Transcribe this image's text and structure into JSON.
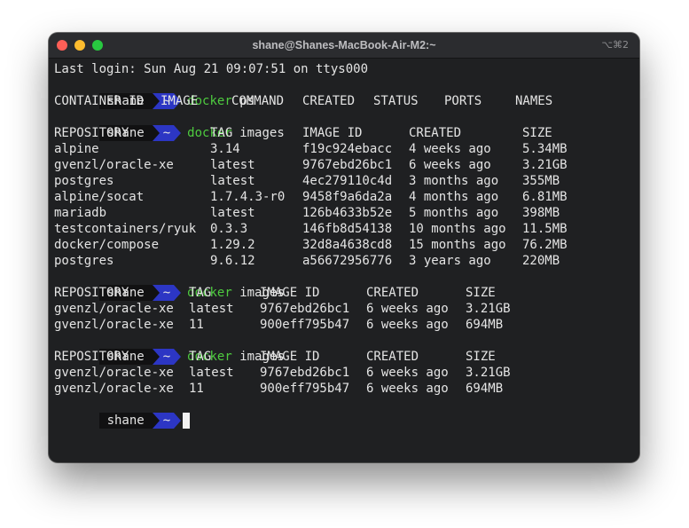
{
  "window": {
    "title": "shane@Shanes-MacBook-Air-M2:~",
    "shortcut": "⌥⌘2"
  },
  "terminal": {
    "last_login": "Last login: Sun Aug 21 09:07:51 on ttys000",
    "prompt": {
      "user": "shane",
      "dir": "~"
    },
    "ps": {
      "command": {
        "bin": "docker",
        "args": "ps"
      },
      "headers": [
        "CONTAINER ID",
        "IMAGE",
        "COMMAND",
        "CREATED",
        "STATUS",
        "PORTS",
        "NAMES"
      ]
    },
    "images1": {
      "command": {
        "bin": "docker",
        "args": "images"
      },
      "headers": [
        "REPOSITORY",
        "TAG",
        "IMAGE ID",
        "CREATED",
        "SIZE"
      ],
      "rows": [
        [
          "alpine",
          "3.14",
          "f19c924ebacc",
          "4 weeks ago",
          "5.34MB"
        ],
        [
          "gvenzl/oracle-xe",
          "latest",
          "9767ebd26bc1",
          "6 weeks ago",
          "3.21GB"
        ],
        [
          "postgres",
          "latest",
          "4ec279110c4d",
          "3 months ago",
          "355MB"
        ],
        [
          "alpine/socat",
          "1.7.4.3-r0",
          "9458f9a6da2a",
          "4 months ago",
          "6.81MB"
        ],
        [
          "mariadb",
          "latest",
          "126b4633b52e",
          "5 months ago",
          "398MB"
        ],
        [
          "testcontainers/ryuk",
          "0.3.3",
          "146fb8d54138",
          "10 months ago",
          "11.5MB"
        ],
        [
          "docker/compose",
          "1.29.2",
          "32d8a4638cd8",
          "15 months ago",
          "76.2MB"
        ],
        [
          "postgres",
          "9.6.12",
          "a56672956776",
          "3 years ago",
          "220MB"
        ]
      ]
    },
    "images2": {
      "command": {
        "bin": "docker",
        "args": "images"
      },
      "headers": [
        "REPOSITORY",
        "TAG",
        "IMAGE ID",
        "CREATED",
        "SIZE"
      ],
      "rows": [
        [
          "gvenzl/oracle-xe",
          "latest",
          "9767ebd26bc1",
          "6 weeks ago",
          "3.21GB"
        ],
        [
          "gvenzl/oracle-xe",
          "11",
          "900eff795b47",
          "6 weeks ago",
          "694MB"
        ]
      ]
    },
    "images3": {
      "command": {
        "bin": "docker",
        "args": "images"
      },
      "headers": [
        "REPOSITORY",
        "TAG",
        "IMAGE ID",
        "CREATED",
        "SIZE"
      ],
      "rows": [
        [
          "gvenzl/oracle-xe",
          "latest",
          "9767ebd26bc1",
          "6 weeks ago",
          "3.21GB"
        ],
        [
          "gvenzl/oracle-xe",
          "11",
          "900eff795b47",
          "6 weeks ago",
          "694MB"
        ]
      ]
    }
  }
}
